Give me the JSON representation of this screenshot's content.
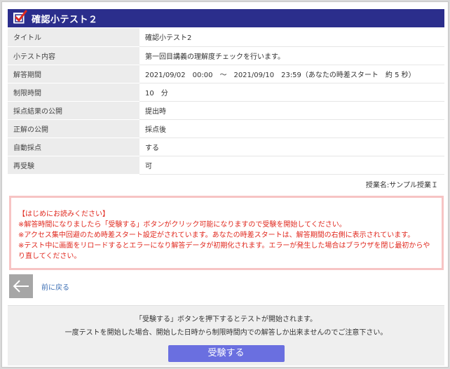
{
  "header": {
    "title": "確認小テスト２"
  },
  "info_rows": [
    {
      "key": "タイトル",
      "value": "確認小テスト2"
    },
    {
      "key": "小テスト内容",
      "value": "第一回目講義の理解度チェックを行います。"
    },
    {
      "key": "解答期間",
      "value": "2021/09/02　00:00　～　2021/09/10　23:59（あなたの時差スタート　約 5 秒）"
    },
    {
      "key": "制限時間",
      "value": "10　分"
    },
    {
      "key": "採点結果の公開",
      "value": "提出時"
    },
    {
      "key": "正解の公開",
      "value": "採点後"
    },
    {
      "key": "自動採点",
      "value": "する"
    },
    {
      "key": "再受験",
      "value": "可"
    }
  ],
  "class_name": "授業名:サンプル授業Ｉ",
  "notice": {
    "heading": "【はじめにお読みください】",
    "lines": [
      "※解答時間になりましたら「受験する」ボタンがクリック可能になりますので受験を開始してください。",
      "※アクセス集中回避のため時差スタート設定がされています。あなたの時差スタートは、解答期間の右側に表示されています。",
      "※テスト中に画面をリロードするとエラーになり解答データが初期化されます。エラーが発生した場合はブラウザを閉じ最初からやり直してください。"
    ]
  },
  "back_link": "前に戻る",
  "bottom": {
    "line1": "「受験する」ボタンを押下するとテストが開始されます。",
    "line2": "一度テストを開始した場合、開始した日時から制限時間内での解答しか出来ませんのでご注意下さい。",
    "start_button": "受験する"
  },
  "colors": {
    "header_bg": "#2b2e8c",
    "notice_text": "#e0281e",
    "notice_border": "#f7c4c4",
    "button_bg": "#6a6fe0",
    "link": "#3c6fb4"
  },
  "icons": [
    "checkbox-check-icon",
    "back-arrow-icon"
  ]
}
